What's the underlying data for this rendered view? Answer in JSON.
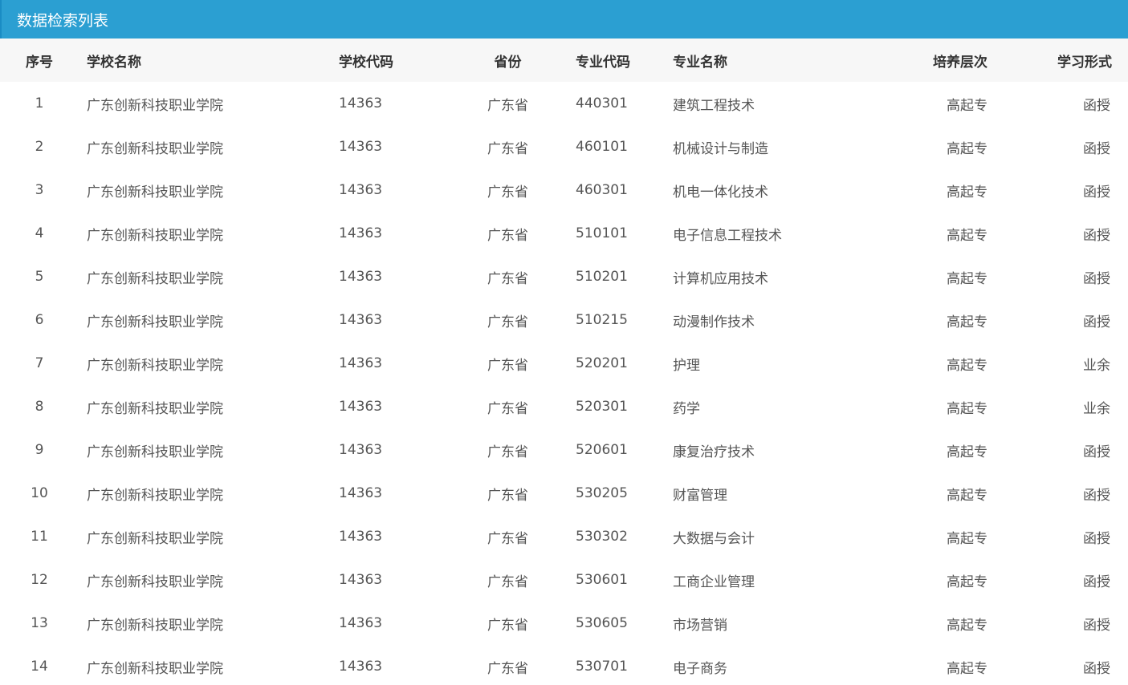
{
  "panel": {
    "title": "数据检索列表"
  },
  "columns": {
    "idx": "序号",
    "school": "学校名称",
    "code": "学校代码",
    "province": "省份",
    "major_code": "专业代码",
    "major_name": "专业名称",
    "level": "培养层次",
    "form": "学习形式"
  },
  "rows": [
    {
      "idx": "1",
      "school": "广东创新科技职业学院",
      "code": "14363",
      "province": "广东省",
      "major_code": "440301",
      "major_name": "建筑工程技术",
      "level": "高起专",
      "form": "函授"
    },
    {
      "idx": "2",
      "school": "广东创新科技职业学院",
      "code": "14363",
      "province": "广东省",
      "major_code": "460101",
      "major_name": "机械设计与制造",
      "level": "高起专",
      "form": "函授"
    },
    {
      "idx": "3",
      "school": "广东创新科技职业学院",
      "code": "14363",
      "province": "广东省",
      "major_code": "460301",
      "major_name": "机电一体化技术",
      "level": "高起专",
      "form": "函授"
    },
    {
      "idx": "4",
      "school": "广东创新科技职业学院",
      "code": "14363",
      "province": "广东省",
      "major_code": "510101",
      "major_name": "电子信息工程技术",
      "level": "高起专",
      "form": "函授"
    },
    {
      "idx": "5",
      "school": "广东创新科技职业学院",
      "code": "14363",
      "province": "广东省",
      "major_code": "510201",
      "major_name": "计算机应用技术",
      "level": "高起专",
      "form": "函授"
    },
    {
      "idx": "6",
      "school": "广东创新科技职业学院",
      "code": "14363",
      "province": "广东省",
      "major_code": "510215",
      "major_name": "动漫制作技术",
      "level": "高起专",
      "form": "函授"
    },
    {
      "idx": "7",
      "school": "广东创新科技职业学院",
      "code": "14363",
      "province": "广东省",
      "major_code": "520201",
      "major_name": "护理",
      "level": "高起专",
      "form": "业余"
    },
    {
      "idx": "8",
      "school": "广东创新科技职业学院",
      "code": "14363",
      "province": "广东省",
      "major_code": "520301",
      "major_name": "药学",
      "level": "高起专",
      "form": "业余"
    },
    {
      "idx": "9",
      "school": "广东创新科技职业学院",
      "code": "14363",
      "province": "广东省",
      "major_code": "520601",
      "major_name": "康复治疗技术",
      "level": "高起专",
      "form": "函授"
    },
    {
      "idx": "10",
      "school": "广东创新科技职业学院",
      "code": "14363",
      "province": "广东省",
      "major_code": "530205",
      "major_name": "财富管理",
      "level": "高起专",
      "form": "函授"
    },
    {
      "idx": "11",
      "school": "广东创新科技职业学院",
      "code": "14363",
      "province": "广东省",
      "major_code": "530302",
      "major_name": "大数据与会计",
      "level": "高起专",
      "form": "函授"
    },
    {
      "idx": "12",
      "school": "广东创新科技职业学院",
      "code": "14363",
      "province": "广东省",
      "major_code": "530601",
      "major_name": "工商企业管理",
      "level": "高起专",
      "form": "函授"
    },
    {
      "idx": "13",
      "school": "广东创新科技职业学院",
      "code": "14363",
      "province": "广东省",
      "major_code": "530605",
      "major_name": "市场营销",
      "level": "高起专",
      "form": "函授"
    },
    {
      "idx": "14",
      "school": "广东创新科技职业学院",
      "code": "14363",
      "province": "广东省",
      "major_code": "530701",
      "major_name": "电子商务",
      "level": "高起专",
      "form": "函授"
    }
  ],
  "colors": {
    "header_bg": "#2b9fd2",
    "thead_bg": "#f7f7f7",
    "text": "#555555"
  }
}
